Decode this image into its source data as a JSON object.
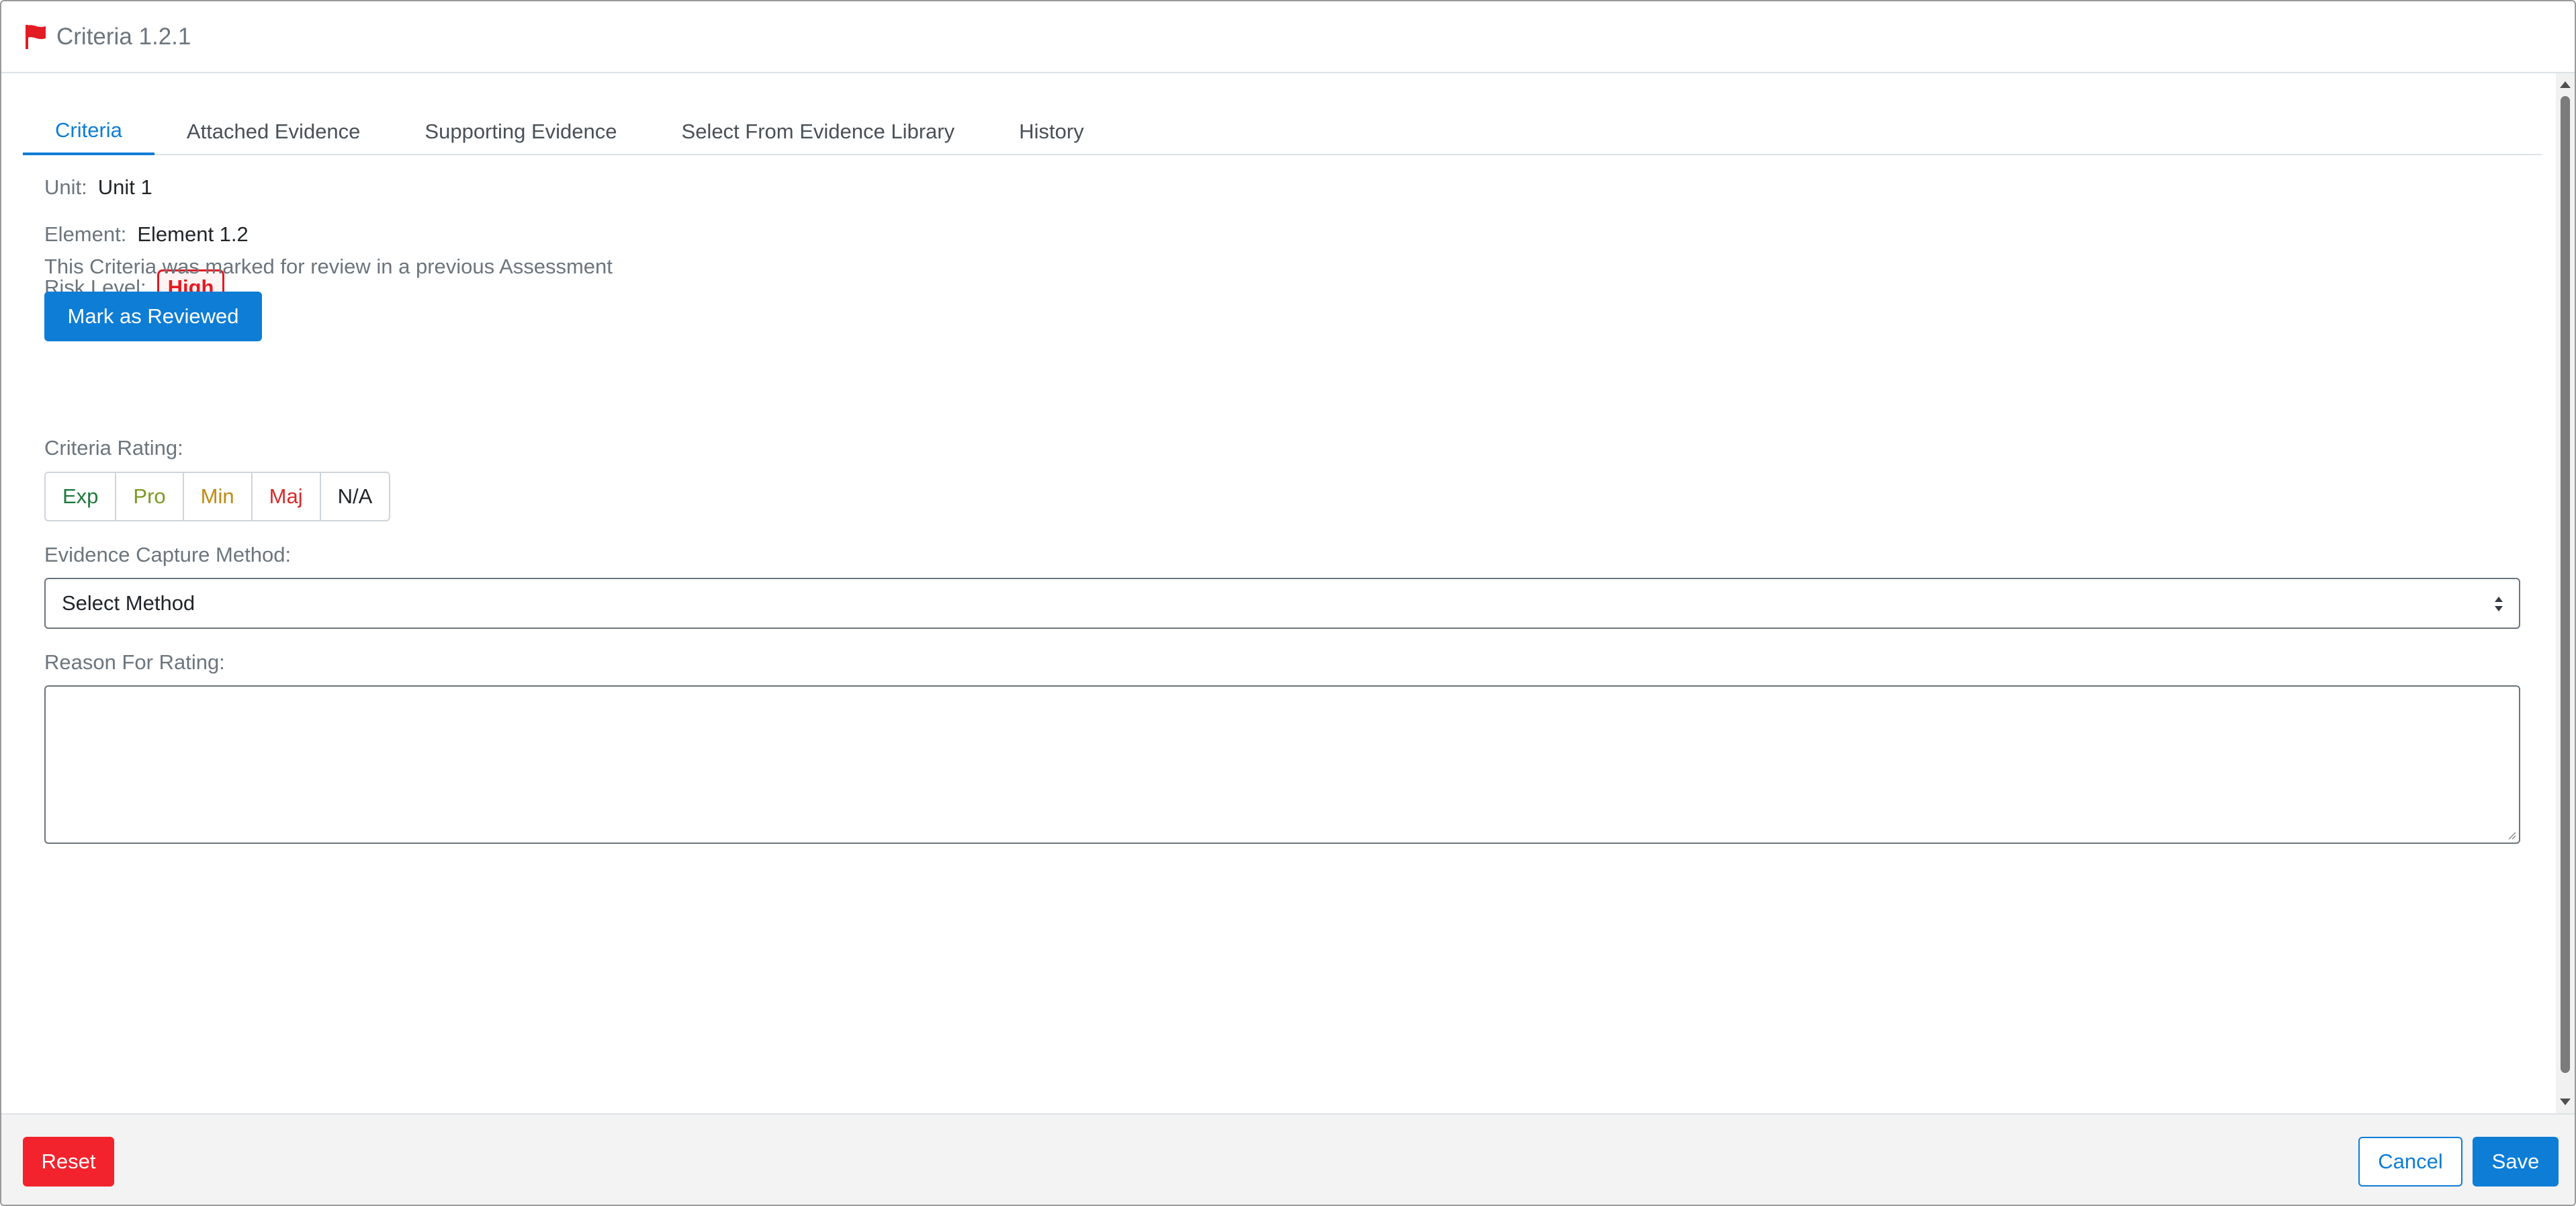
{
  "header": {
    "title": "Criteria 1.2.1",
    "flag_icon": "flag-icon",
    "flag_color": "#e31b23"
  },
  "tabs": [
    {
      "label": "Criteria",
      "active": true
    },
    {
      "label": "Attached Evidence",
      "active": false
    },
    {
      "label": "Supporting Evidence",
      "active": false
    },
    {
      "label": "Select From Evidence Library",
      "active": false
    },
    {
      "label": "History",
      "active": false
    }
  ],
  "criteria": {
    "unit_label": "Unit:",
    "unit_value": "Unit 1",
    "element_label": "Element:",
    "element_value": "Element 1.2",
    "risk_label": "Risk Level:",
    "risk_value": "High",
    "review_note": "This Criteria was marked for review in a previous Assessment",
    "mark_reviewed_label": "Mark as Reviewed",
    "rating_label": "Criteria Rating:",
    "ratings": [
      {
        "label": "Exp",
        "color": "#1f7a3f"
      },
      {
        "label": "Pro",
        "color": "#7a9a1f"
      },
      {
        "label": "Min",
        "color": "#c08a0f"
      },
      {
        "label": "Maj",
        "color": "#d62a2a"
      },
      {
        "label": "N/A",
        "color": "#212529"
      }
    ],
    "capture_label": "Evidence Capture Method:",
    "capture_selected": "Select Method",
    "reason_label": "Reason For Rating:",
    "reason_value": ""
  },
  "footer": {
    "reset_label": "Reset",
    "cancel_label": "Cancel",
    "save_label": "Save"
  },
  "colors": {
    "accent": "#0d7dd6",
    "danger": "#f2232c"
  }
}
